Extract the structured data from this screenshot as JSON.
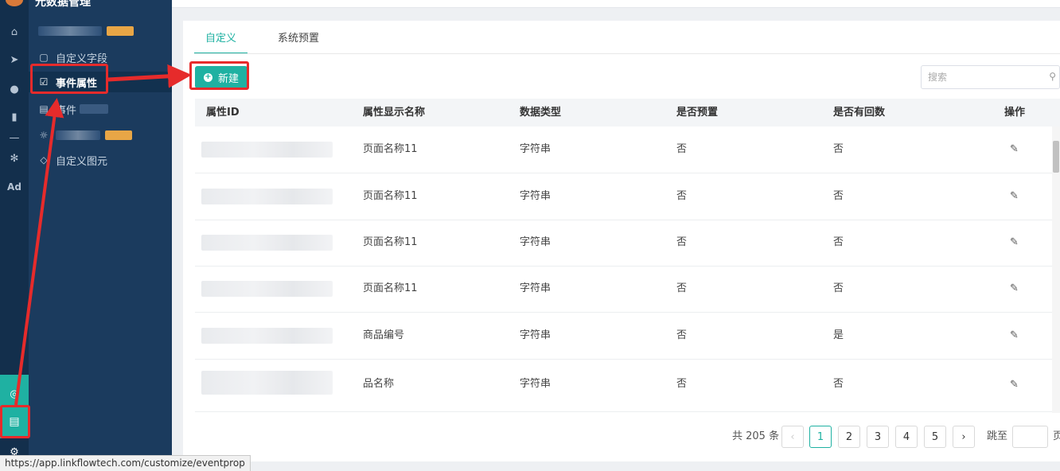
{
  "app": {
    "title": "元数据管理"
  },
  "rail": {
    "icons": [
      "home-icon",
      "send-icon",
      "user-icon",
      "bar-chart-icon",
      "divider-icon",
      "wechat-icon",
      "ad-icon",
      "target-icon",
      "server-icon",
      "gear-icon"
    ],
    "ad_label": "Ad"
  },
  "sidebar": {
    "items": [
      {
        "label": "",
        "icon": "blurred"
      },
      {
        "label": "自定义字段",
        "icon": "field-icon"
      },
      {
        "label": "事件属性",
        "icon": "clipboard-icon"
      },
      {
        "label": "事件",
        "icon": "list-icon"
      },
      {
        "label": "",
        "icon": "sun-icon"
      },
      {
        "label": "自定义图元",
        "icon": "shapes-icon"
      }
    ]
  },
  "tabs": [
    {
      "label": "自定义"
    },
    {
      "label": "系统预置"
    }
  ],
  "toolbar": {
    "new_label": "新建"
  },
  "search": {
    "placeholder": "搜索"
  },
  "table": {
    "columns": [
      "属性ID",
      "属性显示名称",
      "数据类型",
      "是否预置",
      "是否有回数",
      "操作"
    ],
    "rows": [
      {
        "name": "页面名称11",
        "type": "字符串",
        "preset": "否",
        "has_data": "否"
      },
      {
        "name": "页面名称11",
        "type": "字符串",
        "preset": "否",
        "has_data": "否"
      },
      {
        "name": "页面名称11",
        "type": "字符串",
        "preset": "否",
        "has_data": "否"
      },
      {
        "name": "页面名称11",
        "type": "字符串",
        "preset": "否",
        "has_data": "否"
      },
      {
        "name": "商品编号",
        "type": "字符串",
        "preset": "否",
        "has_data": "是"
      },
      {
        "name": "品名称",
        "type": "字符串",
        "preset": "否",
        "has_data": "否"
      }
    ]
  },
  "pagination": {
    "total": "共 205 条",
    "pages": [
      "1",
      "2",
      "3",
      "4",
      "5"
    ],
    "current": "1",
    "prev": "‹",
    "next": "›",
    "jump_label": "跳至",
    "page_suffix": "页"
  },
  "status_url": "https://app.linkflowtech.com/customize/eventprop",
  "colors": {
    "accent": "#1fb1a2",
    "rail": "#132f4c",
    "sidebar": "#1b3b5e",
    "annotation": "#e62b2b"
  }
}
